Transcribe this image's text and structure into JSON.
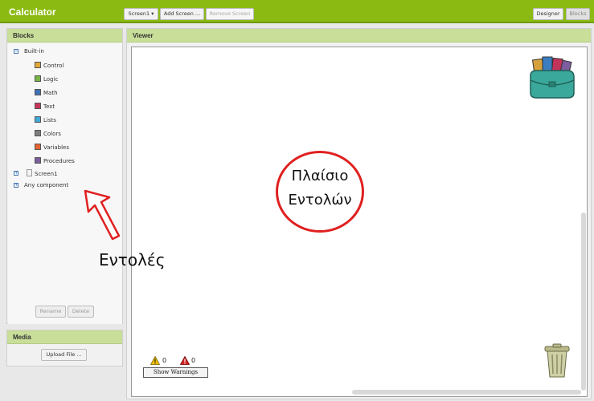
{
  "app": {
    "title": "Calculator"
  },
  "toolbar": {
    "screen_select": "Screen1 ▾",
    "add_screen": "Add Screen ...",
    "remove_screen": "Remove Screen",
    "designer": "Designer",
    "blocks": "Blocks"
  },
  "blocks_panel": {
    "title": "Blocks",
    "builtin_label": "Built-in",
    "items": [
      {
        "label": "Control",
        "color": "#e1a83a"
      },
      {
        "label": "Logic",
        "color": "#78b545"
      },
      {
        "label": "Math",
        "color": "#3f71b5"
      },
      {
        "label": "Text",
        "color": "#c9355a"
      },
      {
        "label": "Lists",
        "color": "#3fa9d8"
      },
      {
        "label": "Colors",
        "color": "#7d7d7d"
      },
      {
        "label": "Variables",
        "color": "#e4642e"
      },
      {
        "label": "Procedures",
        "color": "#7b5d9c"
      }
    ],
    "screen_item": "Screen1",
    "any_component": "Any component",
    "rename": "Rename",
    "delete": "Delete"
  },
  "media_panel": {
    "title": "Media",
    "upload": "Upload File ..."
  },
  "viewer": {
    "title": "Viewer",
    "warning_count": "0",
    "error_count": "0",
    "show_warnings": "Show Warnings"
  },
  "annotations": {
    "circle_line1": "Πλαίσιο",
    "circle_line2": "Εντολών",
    "arrow_label": "Εντολές",
    "circle_color": "#e02020"
  }
}
